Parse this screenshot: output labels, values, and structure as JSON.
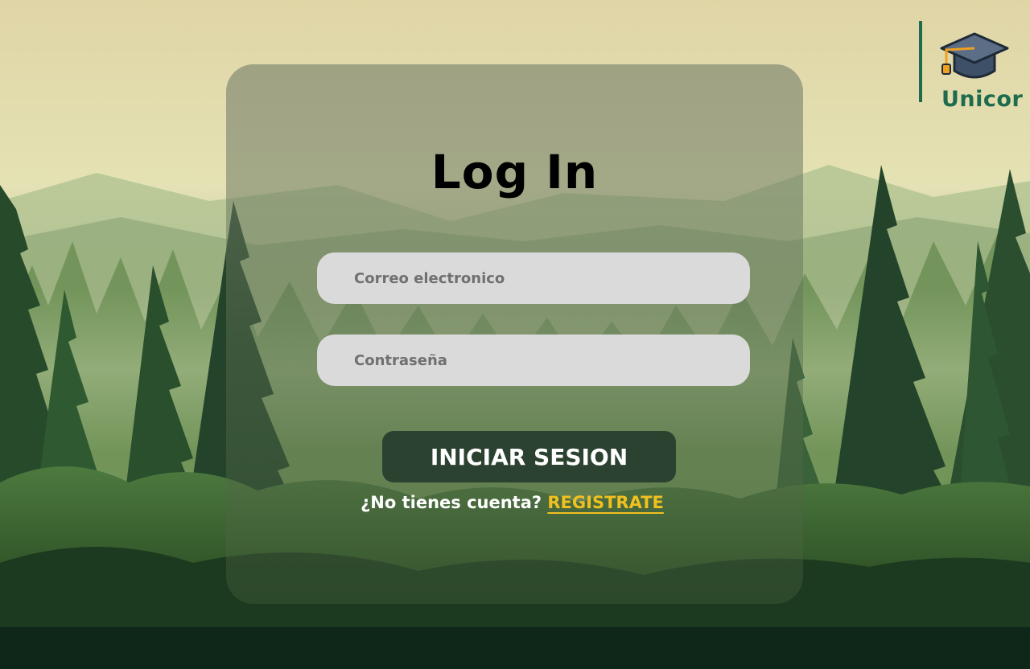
{
  "brand": {
    "name": "Unicor",
    "logo_icon": "graduation-cap-icon",
    "accent_color": "#1e6b4e"
  },
  "login": {
    "title": "Log In",
    "email_placeholder": "Correo electronico",
    "password_placeholder": "Contraseña",
    "submit_label": "INICIAR SESION",
    "no_account_text": "¿No tienes cuenta?",
    "register_link": "REGISTRATE",
    "button_color": "#2c4230",
    "link_color": "#f0c020"
  }
}
